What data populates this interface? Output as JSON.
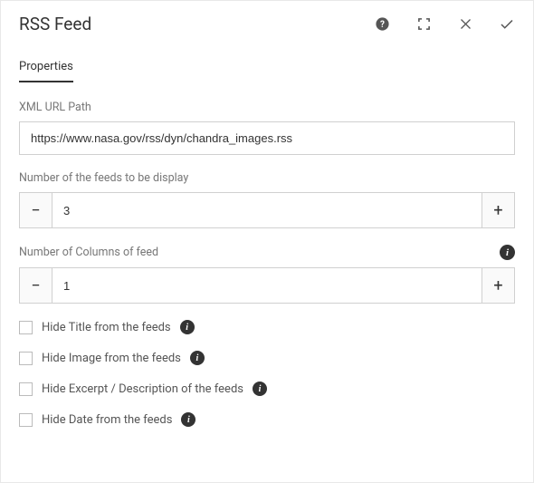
{
  "header": {
    "title": "RSS Feed"
  },
  "tabs": {
    "active": "Properties"
  },
  "fields": {
    "xmlUrl": {
      "label": "XML URL Path",
      "value": "https://www.nasa.gov/rss/dyn/chandra_images.rss"
    },
    "feedCount": {
      "label": "Number of the feeds to be display",
      "value": "3"
    },
    "columnCount": {
      "label": "Number of Columns of feed",
      "value": "1"
    }
  },
  "checkboxes": {
    "hideTitle": {
      "label": "Hide Title from the feeds",
      "checked": false
    },
    "hideImage": {
      "label": "Hide Image from the feeds",
      "checked": false
    },
    "hideExcerpt": {
      "label": "Hide Excerpt / Description of the feeds",
      "checked": false
    },
    "hideDate": {
      "label": "Hide Date from the feeds",
      "checked": false
    }
  },
  "glyphs": {
    "minus": "−",
    "plus": "+",
    "info": "i"
  }
}
